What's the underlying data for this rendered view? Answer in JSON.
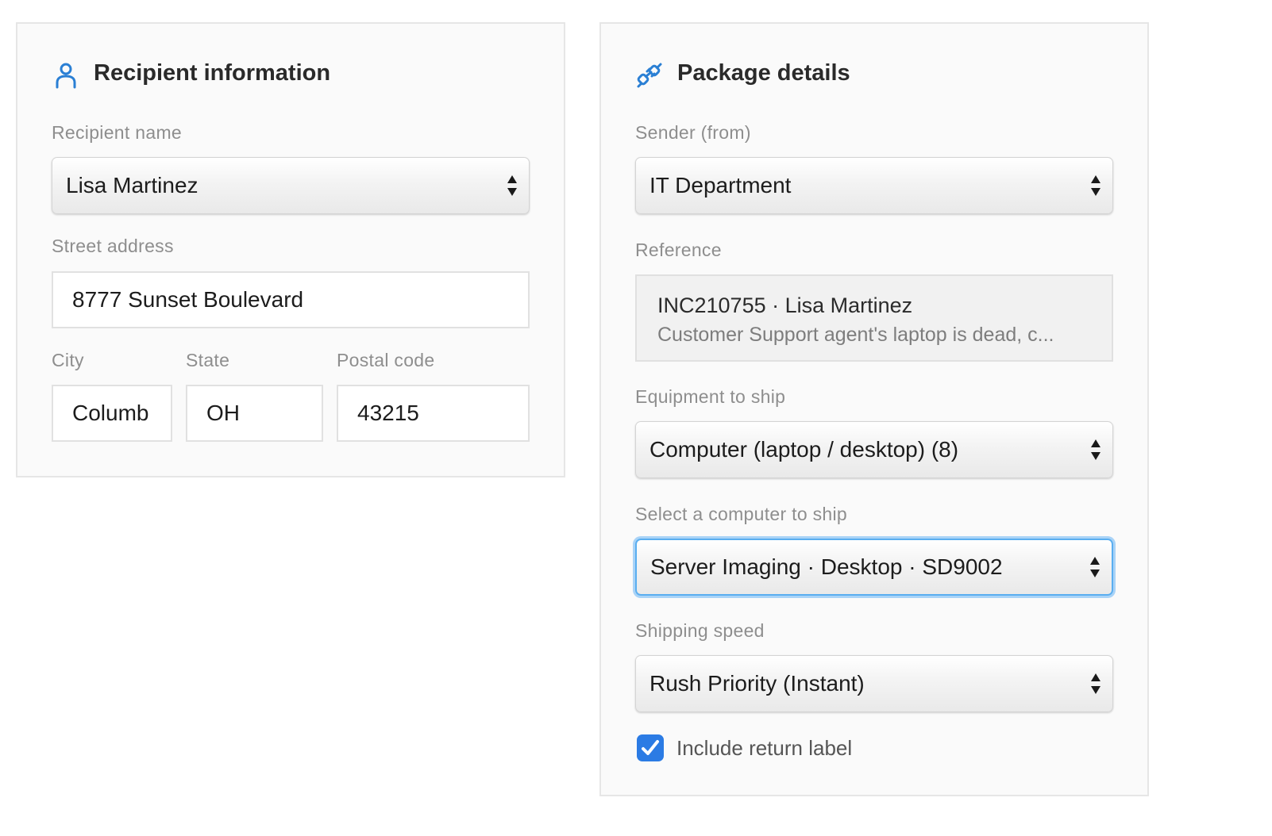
{
  "recipient": {
    "title": "Recipient information",
    "icon": "person-icon",
    "accent_color": "#2a7fd4",
    "name_label": "Recipient name",
    "name_value": "Lisa Martinez",
    "street_label": "Street address",
    "street_value": "8777 Sunset Boulevard",
    "city_label": "City",
    "city_value": "Columb",
    "state_label": "State",
    "state_value": "OH",
    "postal_label": "Postal code",
    "postal_value": "43215"
  },
  "package": {
    "title": "Package details",
    "icon": "plug-icon",
    "sender_label": "Sender (from)",
    "sender_value": "IT Department",
    "reference_label": "Reference",
    "reference_line1": "INC210755 · Lisa Martinez",
    "reference_line2": "Customer Support agent's laptop is dead, c...",
    "equipment_label": "Equipment to ship",
    "equipment_value": "Computer (laptop / desktop) (8)",
    "computer_label": "Select a computer to ship",
    "computer_value": "Server Imaging · Desktop · SD9002",
    "speed_label": "Shipping speed",
    "speed_value": "Rush Priority (Instant)",
    "return_label_text": "Include return label",
    "return_label_checked": true,
    "focus_color": "#5aaef0",
    "checkbox_color": "#2b7be4"
  }
}
